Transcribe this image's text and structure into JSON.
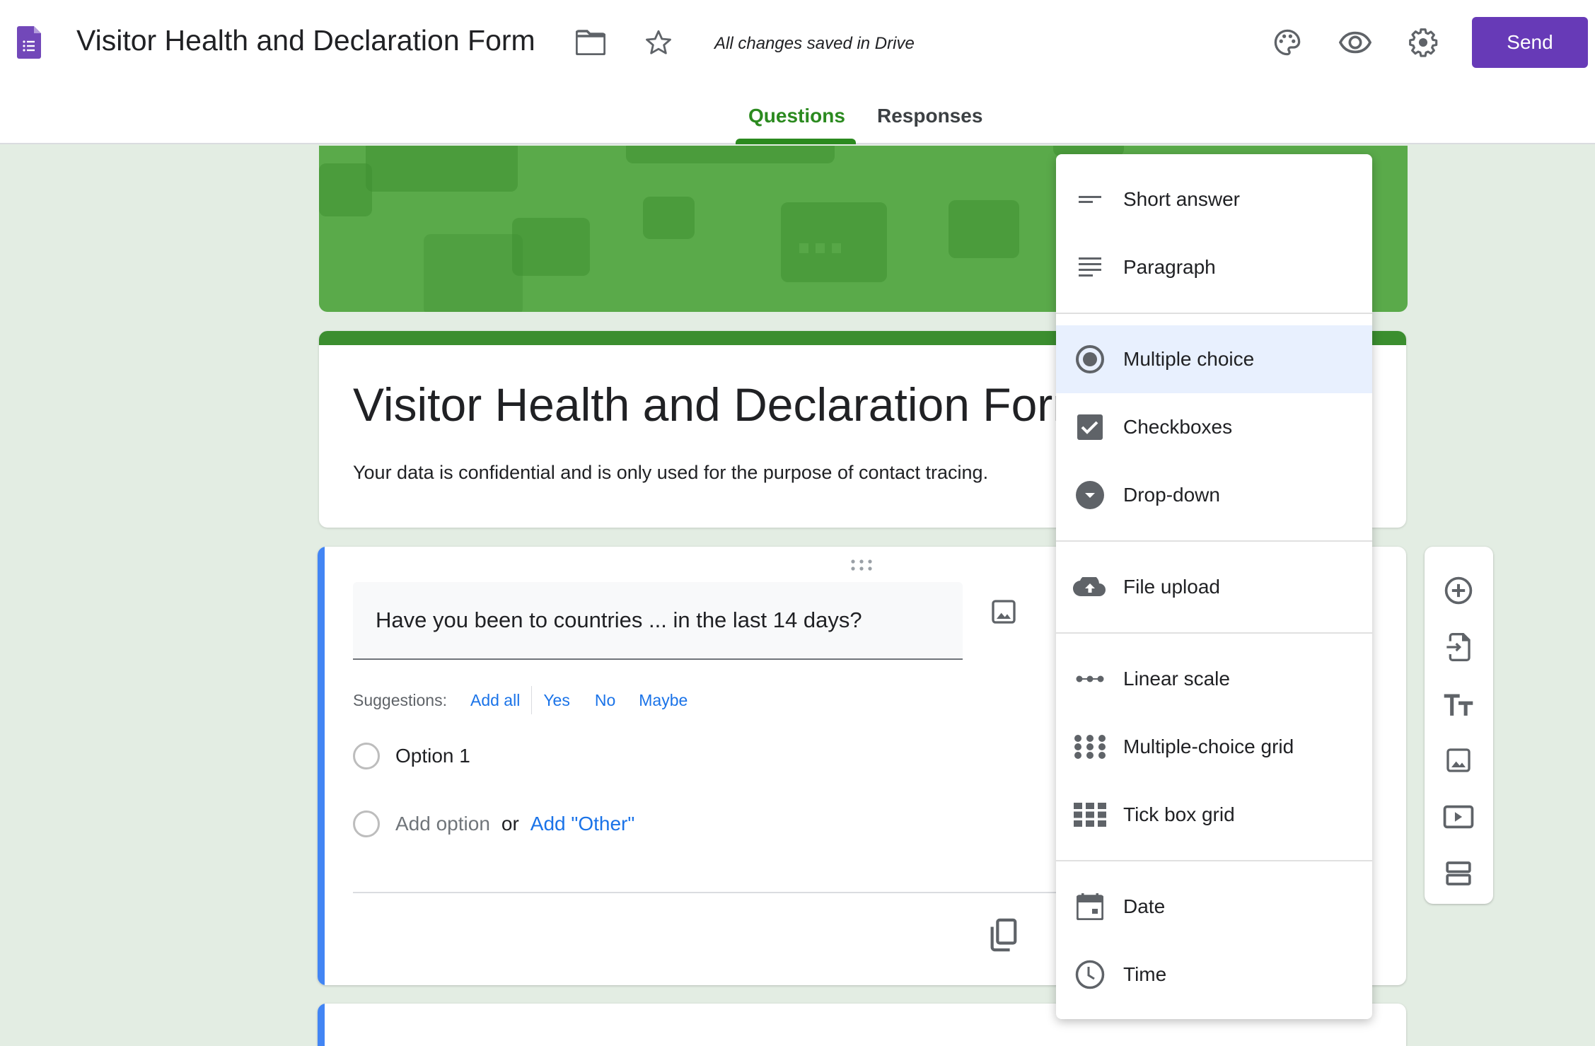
{
  "header": {
    "app_title": "Visitor Health and Declaration Form",
    "save_status": "All changes saved in Drive",
    "send_label": "Send",
    "icons": [
      "forms-logo-icon",
      "folder-icon",
      "star-icon",
      "palette-icon",
      "preview-eye-icon",
      "settings-gear-icon"
    ]
  },
  "tabs": [
    {
      "label": "Questions",
      "active": true
    },
    {
      "label": "Responses",
      "active": false
    }
  ],
  "form": {
    "title": "Visitor Health and Declaration Form",
    "description": "Your data is confidential and is only used for the purpose of contact tracing."
  },
  "question": {
    "text": "Have you been to countries ... in the last 14 days?",
    "suggestions_label": "Suggestions:",
    "suggestions": [
      "Add all",
      "Yes",
      "No",
      "Maybe"
    ],
    "options": [
      "Option 1"
    ],
    "add_option": "Add option",
    "or": "or",
    "add_other": "Add \"Other\""
  },
  "type_menu": {
    "selected": "Multiple choice",
    "items": [
      {
        "label": "Short answer",
        "icon": "short-answer-icon"
      },
      {
        "label": "Paragraph",
        "icon": "paragraph-icon"
      },
      {
        "label": "Multiple choice",
        "icon": "radio-button-icon"
      },
      {
        "label": "Checkboxes",
        "icon": "checkbox-icon"
      },
      {
        "label": "Drop-down",
        "icon": "dropdown-icon"
      },
      {
        "label": "File upload",
        "icon": "cloud-upload-icon"
      },
      {
        "label": "Linear scale",
        "icon": "linear-scale-icon"
      },
      {
        "label": "Multiple-choice grid",
        "icon": "dot-grid-icon"
      },
      {
        "label": "Tick box grid",
        "icon": "square-grid-icon"
      },
      {
        "label": "Date",
        "icon": "calendar-icon"
      },
      {
        "label": "Time",
        "icon": "clock-icon"
      }
    ]
  },
  "side_toolbar": [
    "add-question-icon",
    "import-questions-icon",
    "add-title-icon",
    "add-image-icon",
    "add-video-icon",
    "add-section-icon"
  ],
  "colors": {
    "accent": "#673ab7",
    "theme_green": "#2b8a1f",
    "background": "#e3ede3",
    "link_blue": "#1a73e8",
    "active_card_bar": "#4285f4",
    "selected_menu_bg": "#e8f0fe"
  }
}
